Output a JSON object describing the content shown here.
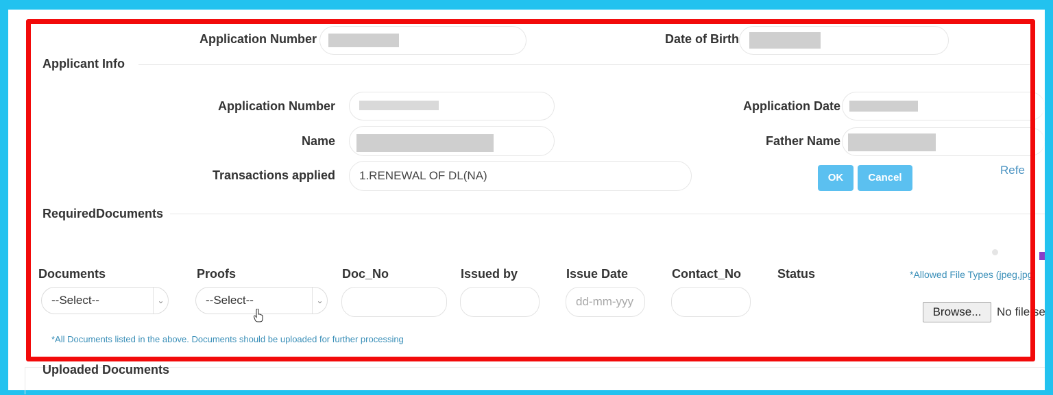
{
  "search": {
    "app_no_label": "Application Number",
    "dob_label": "Date of Birth"
  },
  "applicant_info": {
    "title": "Applicant Info",
    "app_no_label": "Application Number",
    "app_no_value": "",
    "app_date_label": "Application Date",
    "name_label": "Name",
    "father_label": "Father Name",
    "transactions_label": "Transactions applied",
    "transactions_value": "1.RENEWAL OF DL(NA)",
    "ok_label": "OK",
    "cancel_label": "Cancel",
    "reference_link": "Refe"
  },
  "required_documents": {
    "title": "RequiredDocuments",
    "columns": [
      "Documents",
      "Proofs",
      "Doc_No",
      "Issued by",
      "Issue Date",
      "Contact_No",
      "Status"
    ],
    "documents_select": "--Select--",
    "proofs_select": "--Select--",
    "issue_date_placeholder": "dd-mm-yyy",
    "allowed_types": "*Allowed File Types (jpeg,jpg",
    "browse_label": "Browse...",
    "no_file": "No file se",
    "note": "*All Documents listed in the above. Documents should be uploaded for further processing"
  },
  "uploaded_documents": {
    "title": "Uploaded Documents"
  },
  "colors": {
    "frame": "#22c2ef",
    "highlight": "#f20a0a",
    "button": "#5bc0f0",
    "link": "#3a8fb8"
  }
}
